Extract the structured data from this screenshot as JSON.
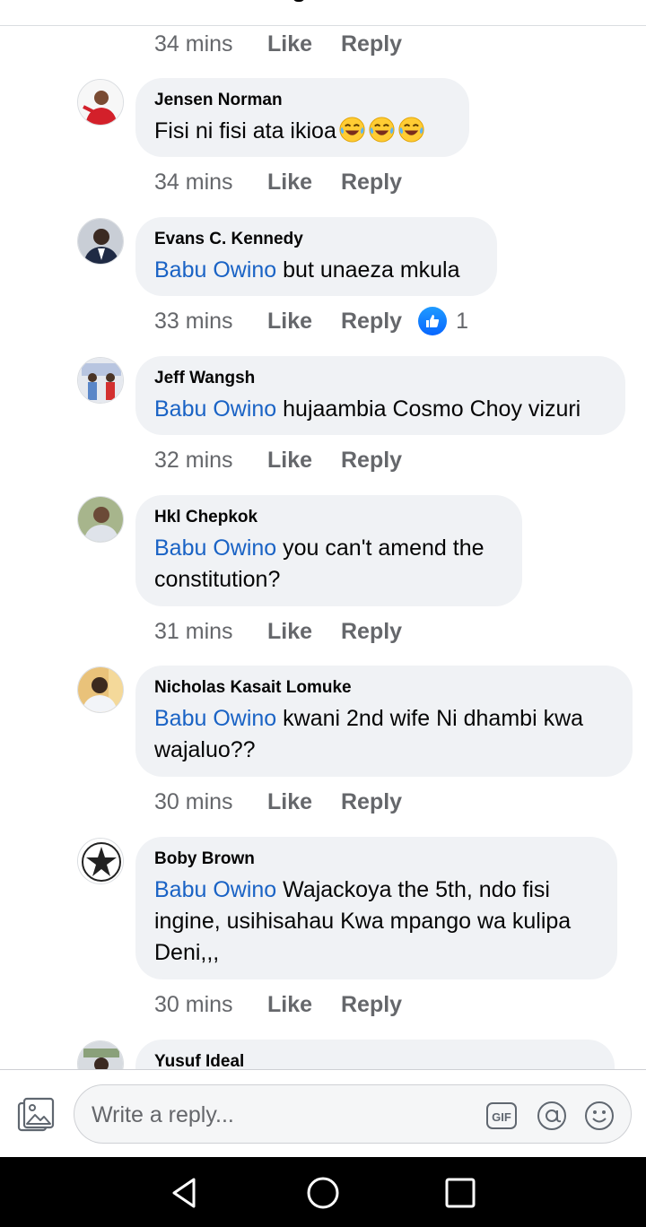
{
  "thread": {
    "first_meta": {
      "time": "34 mins",
      "like": "Like",
      "reply": "Reply"
    },
    "comments": [
      {
        "author": "Jensen Norman",
        "mention": "",
        "text": "Fisi ni fisi ata ikioa",
        "emojis": [
          "laughing-tears",
          "laughing-tears",
          "laughing-tears"
        ],
        "time": "34 mins",
        "like": "Like",
        "reply": "Reply"
      },
      {
        "author": "Evans C. Kennedy",
        "mention": "Babu Owino",
        "text": " but unaeza mkula",
        "time": "33 mins",
        "like": "Like",
        "reply": "Reply",
        "reaction": {
          "icon": "thumbs-up-icon",
          "count": "1"
        }
      },
      {
        "author": "Jeff Wangsh",
        "mention": "Babu Owino",
        "text": " hujaambia Cosmo Choy vizuri",
        "time": "32 mins",
        "like": "Like",
        "reply": "Reply"
      },
      {
        "author": "Hkl Chepkok",
        "mention": "Babu Owino",
        "text": " you can't amend the constitution?",
        "time": "31 mins",
        "like": "Like",
        "reply": "Reply"
      },
      {
        "author": "Nicholas Kasait Lomuke",
        "mention": "Babu Owino",
        "text": " kwani 2nd wife Ni dhambi kwa wajaluo??",
        "time": "30 mins",
        "like": "Like",
        "reply": "Reply"
      },
      {
        "author": "Boby Brown",
        "mention": "Babu Owino",
        "text": " Wajackoya the 5th, ndo fisi ingine, usihisahau Kwa mpango wa kulipa Deni,,,",
        "time": "30 mins",
        "like": "Like",
        "reply": "Reply"
      },
      {
        "author": "Yusuf Ideal"
      }
    ]
  },
  "composer": {
    "placeholder": "Write a reply...",
    "icons": [
      "photo-gallery-icon",
      "gif-icon",
      "at-mention-icon",
      "emoji-icon"
    ]
  },
  "system_nav": {
    "icons": [
      "back-triangle-icon",
      "home-circle-icon",
      "recents-square-icon"
    ]
  },
  "colors": {
    "mention": "#1a63c5",
    "meta": "#65676b",
    "bubble": "#f0f2f5",
    "like_blue": "#0866ff",
    "navbar": "#000000"
  }
}
